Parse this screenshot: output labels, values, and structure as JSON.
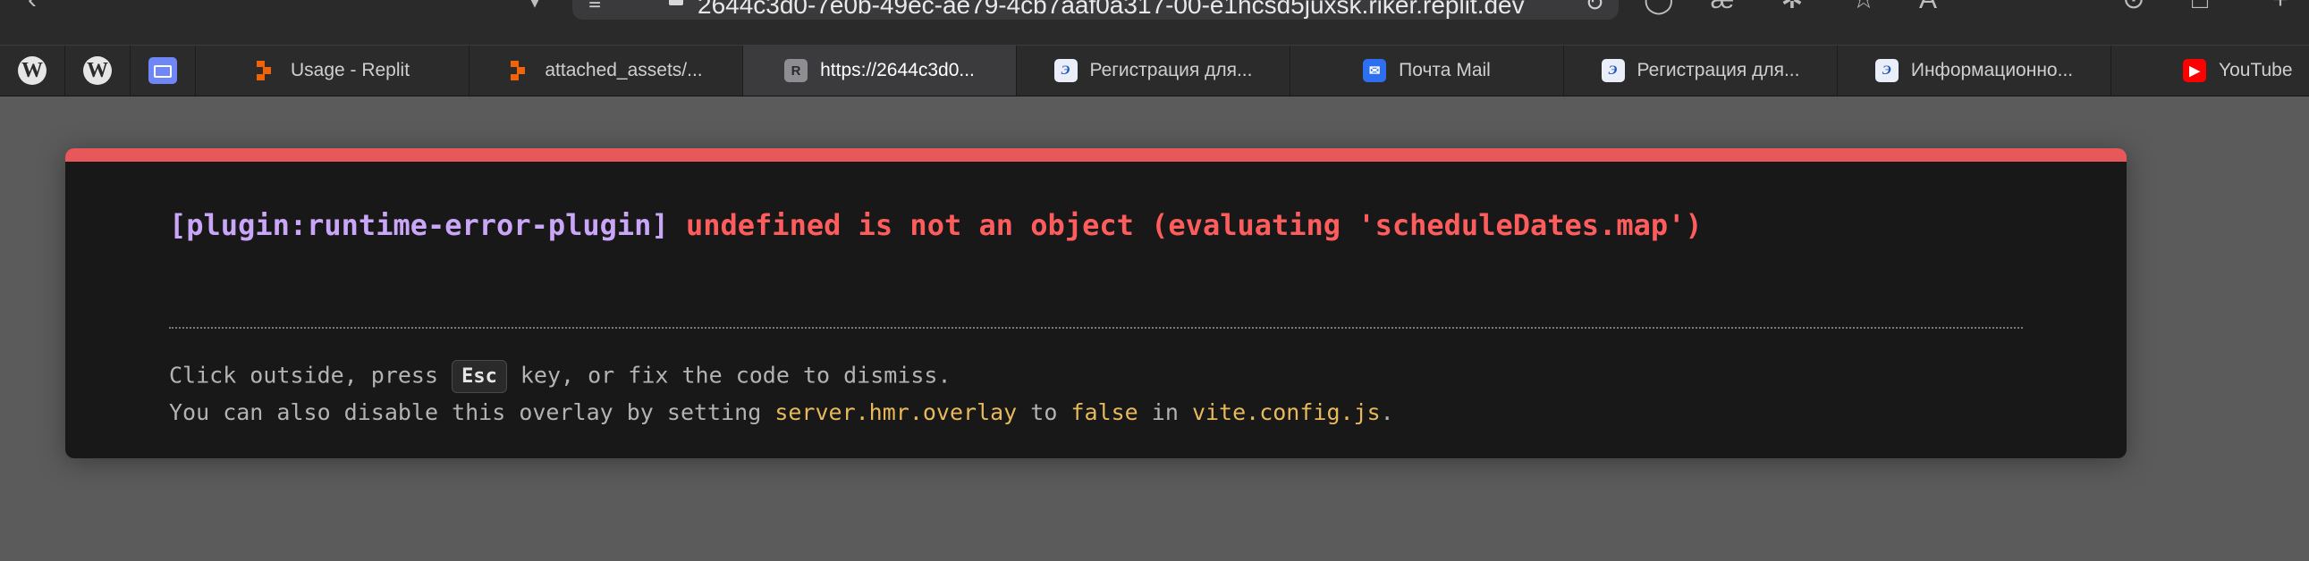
{
  "toolbar": {
    "url": "2644c3d0-7e0b-49ec-ae79-4cb7aaf0a317-00-e1hcsd5juxsk.riker.replit.dev"
  },
  "tabs": {
    "pinned": [
      {
        "icon": "wordpress-icon"
      },
      {
        "icon": "wordpress-icon"
      },
      {
        "icon": "folder-icon"
      }
    ],
    "items": [
      {
        "label": "Usage - Replit",
        "icon": "replit-icon",
        "active": false
      },
      {
        "label": "attached_assets/...",
        "icon": "replit-icon",
        "active": false
      },
      {
        "label": "https://2644c3d0...",
        "icon": "r-letter-icon",
        "icon_text": "R",
        "active": true
      },
      {
        "label": "Регистрация для...",
        "icon": "registration-site-icon",
        "active": false
      },
      {
        "label": "Почта Mail",
        "icon": "mail-icon",
        "active": false
      },
      {
        "label": "Регистрация для...",
        "icon": "registration-site-icon",
        "active": false
      },
      {
        "label": "Информационно...",
        "icon": "registration-site-icon",
        "active": false
      },
      {
        "label": "YouTube",
        "icon": "youtube-icon",
        "active": false
      }
    ]
  },
  "overlay": {
    "accent_color": "#e8575a",
    "plugin": "[plugin:runtime-error-plugin]",
    "message": "undefined is not an object (evaluating 'scheduleDates.map')",
    "tip_line1": {
      "before": "Click outside, press ",
      "key": "Esc",
      "after": " key, or fix the code to dismiss."
    },
    "tip_line2": {
      "t1": "You can also disable this overlay by setting ",
      "code1": "server.hmr.overlay",
      "t2": " to ",
      "code2": "false",
      "t3": " in ",
      "code3": "vite.config.js",
      "t4": "."
    }
  }
}
